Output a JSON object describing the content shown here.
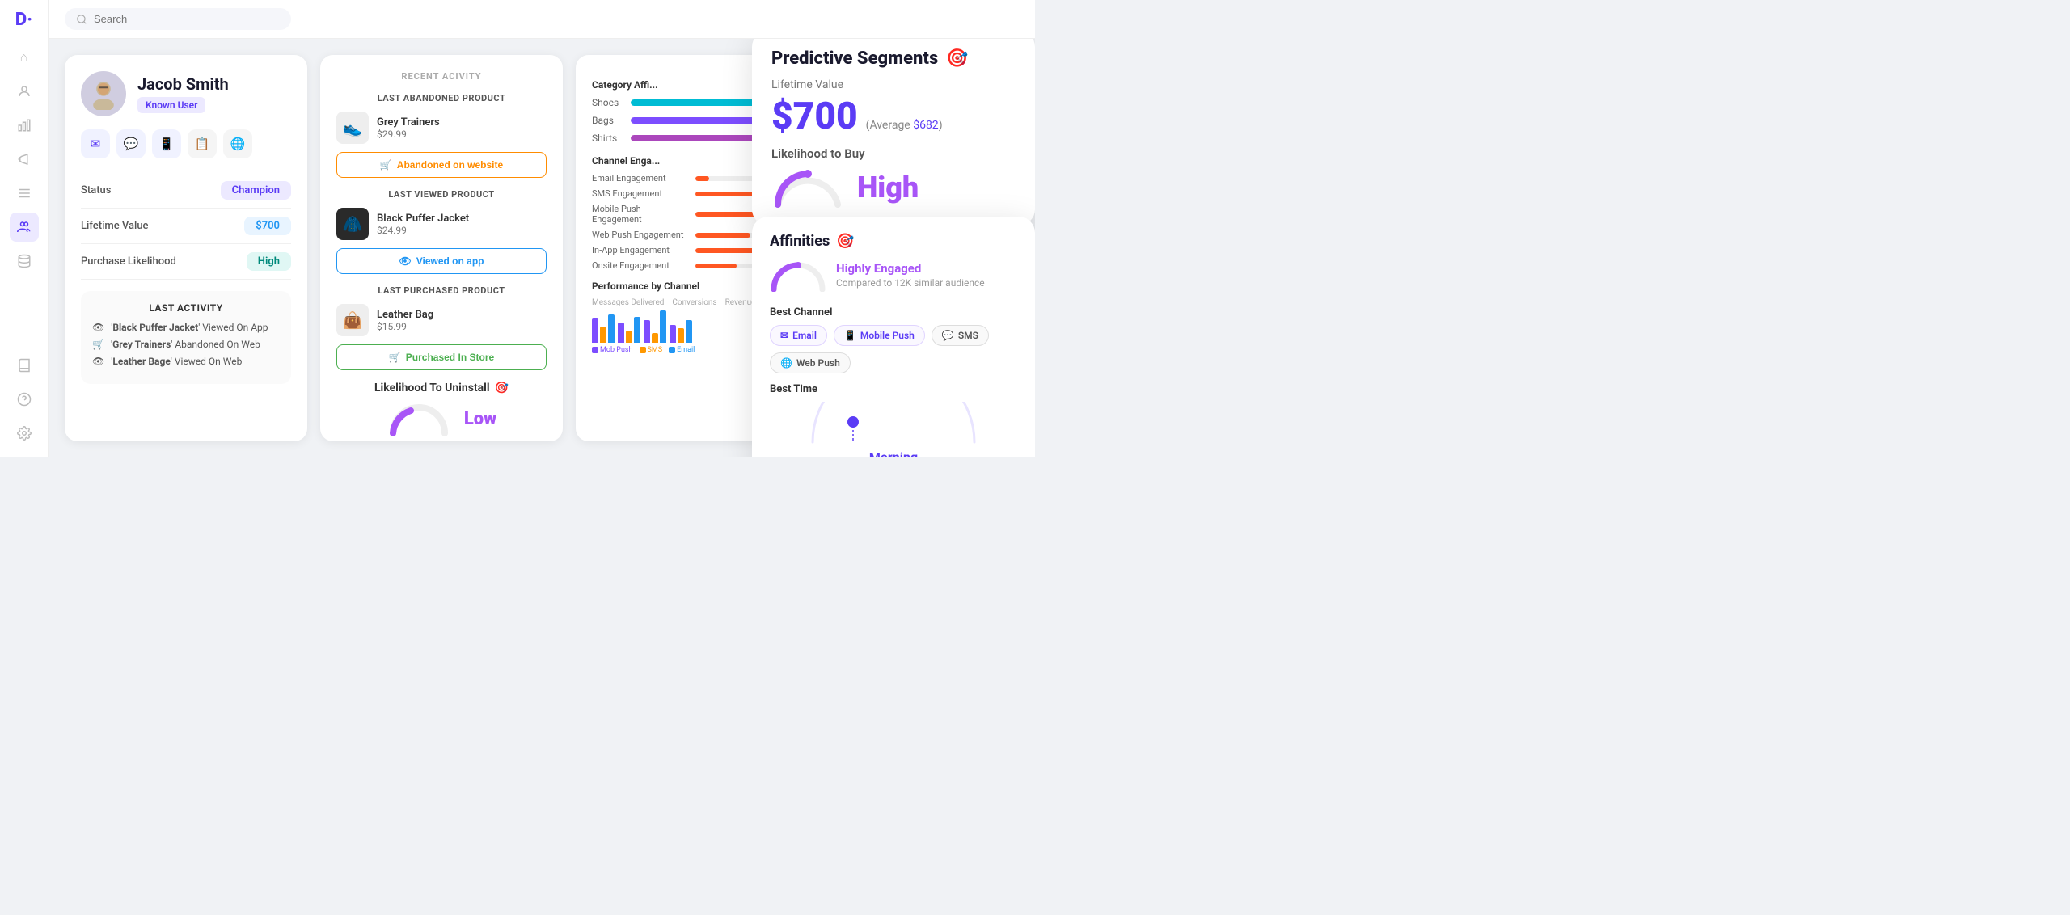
{
  "app": {
    "logo": "D·",
    "search_placeholder": "Search"
  },
  "sidebar": {
    "icons": [
      {
        "name": "home-icon",
        "symbol": "⌂",
        "active": false
      },
      {
        "name": "users-icon",
        "symbol": "◉",
        "active": false
      },
      {
        "name": "chart-icon",
        "symbol": "▦",
        "active": false
      },
      {
        "name": "megaphone-icon",
        "symbol": "📣",
        "active": false
      },
      {
        "name": "list-icon",
        "symbol": "≡",
        "active": false
      },
      {
        "name": "people-icon",
        "symbol": "👥",
        "active": true
      },
      {
        "name": "database-icon",
        "symbol": "⬡",
        "active": false
      },
      {
        "name": "book-icon",
        "symbol": "📖",
        "active": false
      },
      {
        "name": "help-icon",
        "symbol": "?",
        "active": false
      },
      {
        "name": "settings-icon",
        "symbol": "⚙",
        "active": false
      }
    ]
  },
  "profile": {
    "name": "Jacob Smith",
    "badge": "Known User",
    "status_label": "Status",
    "status_value": "Champion",
    "lifetime_value_label": "Lifetime Value",
    "lifetime_value": "$700",
    "purchase_likelihood_label": "Purchase Likelihood",
    "purchase_likelihood": "High",
    "last_activity_title": "LAST ACTIVITY",
    "activities": [
      {
        "icon": "👁",
        "text": "'Black Puffer Jacket' Viewed On App"
      },
      {
        "icon": "🛒",
        "text": "'Grey Trainers' Abandoned On Web"
      },
      {
        "icon": "👁",
        "text": "'Leather Bage' Viewed On Web"
      }
    ]
  },
  "recent_activity": {
    "section_title": "RECENT ACIVITY",
    "abandoned": {
      "label": "LAST ABANDONED PRODUCT",
      "name": "Grey Trainers",
      "price": "$29.99",
      "action": "Abandoned on website",
      "action_highlight": "website"
    },
    "viewed": {
      "label": "LAST VIEWED PRODUCT",
      "name": "Black Puffer Jacket",
      "price": "$24.99",
      "action": "Viewed on app",
      "action_highlight": "app"
    },
    "purchased": {
      "label": "LAST PURCHASED PRODUCT",
      "name": "Leather Bag",
      "price": "$15.99",
      "action": "Purchased In Store",
      "action_highlight": "In Store"
    }
  },
  "uninstall": {
    "title": "Likelihood To Uninstall",
    "value": "Low"
  },
  "analytics": {
    "category_title": "Category Affi...",
    "categories": [
      {
        "label": "Shoes",
        "pct": 75,
        "color": "#00bcd4"
      },
      {
        "label": "Bags",
        "pct": 55,
        "color": "#7c4dff"
      },
      {
        "label": "Shirts",
        "pct": 40,
        "color": "#ab47bc"
      }
    ],
    "channel_title": "Channel Enga...",
    "channels": [
      {
        "label": "Email Engagement",
        "pct": 0,
        "color": "#ff5722",
        "show_bar": false
      },
      {
        "label": "SMS Engagement",
        "pct": 30,
        "color": "#ff5722"
      },
      {
        "label": "Mobile Push Engagement",
        "pct": 66,
        "color": "#ff5722"
      },
      {
        "label": "Web Push Engagement",
        "pct": 20,
        "color": "#ff5722"
      },
      {
        "label": "In-App Engagement",
        "pct": 45,
        "color": "#ff5722"
      },
      {
        "label": "Onsite Engagement",
        "pct": 15,
        "color": "#ff5722"
      }
    ],
    "perf_title": "Performance by Channel"
  },
  "predictive": {
    "title": "Predictive Segments",
    "lifetime_value_label": "Lifetime Value",
    "value": "$700",
    "avg_label": "(Average ",
    "avg_value": "$682",
    "avg_end": ")",
    "ltb_label": "Likelihood to Buy",
    "likelihood": "High"
  },
  "affinities": {
    "title": "Affinities",
    "engaged_label": "Highly Engaged",
    "compared": "Compared to 12K similar audience",
    "best_channel_label": "Best Channel",
    "channels": [
      {
        "label": "Email",
        "icon": "✉"
      },
      {
        "label": "Mobile Push",
        "icon": "📱"
      },
      {
        "label": "SMS",
        "icon": "💬",
        "style": "gray"
      },
      {
        "label": "Web Push",
        "icon": "🌐",
        "style": "gray"
      }
    ],
    "best_time_label": "Best Time",
    "best_time": "Morning"
  }
}
